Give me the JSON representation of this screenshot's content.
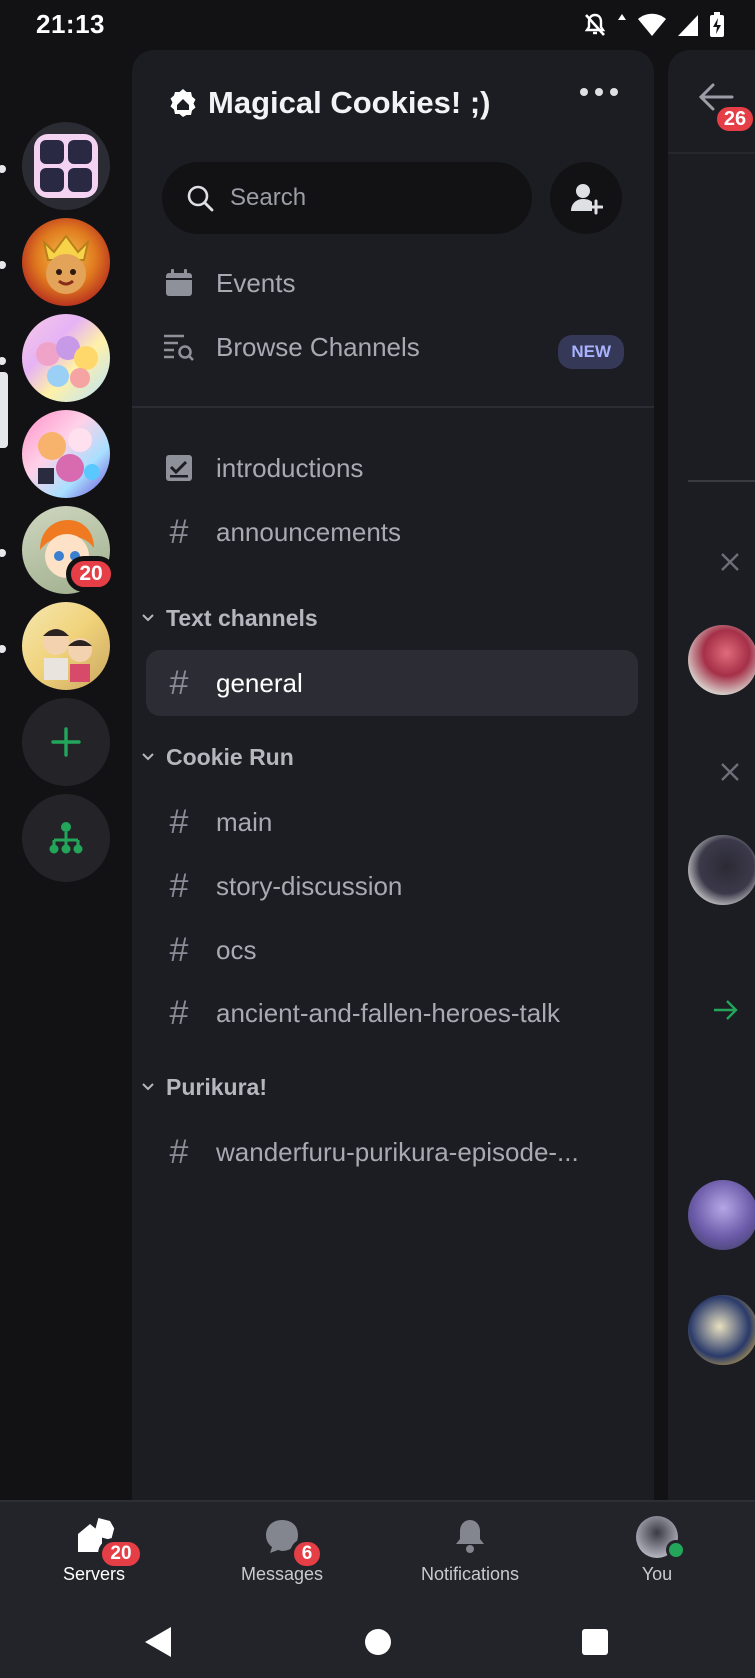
{
  "status_bar": {
    "time": "21:13"
  },
  "server_rail": {
    "servers": [
      {
        "name": "server-grid",
        "badge": ""
      },
      {
        "name": "server-cookie-king",
        "badge": ""
      },
      {
        "name": "server-pastel-group",
        "badge": ""
      },
      {
        "name": "server-anime-collage",
        "badge": "",
        "selected": true
      },
      {
        "name": "server-orange-hair",
        "badge": "20"
      },
      {
        "name": "server-cartoon",
        "badge": ""
      }
    ],
    "accent": "#23a55a"
  },
  "server": {
    "name": "Magical Cookies! ;)",
    "search_placeholder": "Search",
    "events_label": "Events",
    "browse_label": "Browse Channels",
    "new_badge": "NEW"
  },
  "channels": {
    "top": [
      {
        "name": "introductions",
        "icon": "rules-icon"
      },
      {
        "name": "announcements",
        "icon": "hash-icon"
      }
    ],
    "categories": [
      {
        "name": "Text channels",
        "channels": [
          "general"
        ]
      },
      {
        "name": "Cookie Run",
        "channels": [
          "main",
          "story-discussion",
          "ocs",
          "ancient-and-fallen-heroes-talk"
        ]
      },
      {
        "name": "Purikura!",
        "channels": [
          "wanderfuru-purikura-episode-..."
        ]
      }
    ],
    "selected": "general",
    "hash_symbol": "#"
  },
  "peek": {
    "badge": "26"
  },
  "bottom_nav": {
    "servers": {
      "label": "Servers",
      "badge": "20"
    },
    "messages": {
      "label": "Messages",
      "badge": "6"
    },
    "notifications": {
      "label": "Notifications"
    },
    "you": {
      "label": "You"
    }
  }
}
